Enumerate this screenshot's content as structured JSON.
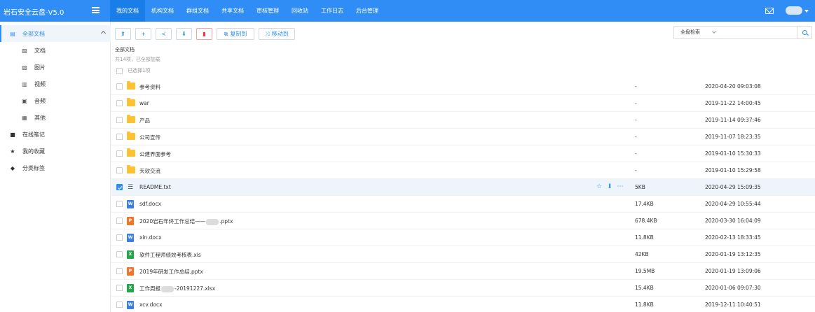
{
  "app": {
    "title": "岩石安全云盘-V5.0"
  },
  "nav": [
    {
      "label": "我的文档",
      "active": true
    },
    {
      "label": "机构文档"
    },
    {
      "label": "群组文档"
    },
    {
      "label": "共享文档"
    },
    {
      "label": "审核管理"
    },
    {
      "label": "回收站"
    },
    {
      "label": "工作日志"
    },
    {
      "label": "后台管理"
    }
  ],
  "sidebar": {
    "all_docs": "全部文档",
    "sub": [
      "文档",
      "图片",
      "视频",
      "音频",
      "其他"
    ],
    "notes": "在线笔记",
    "favorites": "我的收藏",
    "tags": "分类标签"
  },
  "toolbar": {
    "copy_label": "复制到",
    "move_label": "移动到"
  },
  "search": {
    "scope": "全盘检索",
    "placeholder": ""
  },
  "breadcrumb": "全部文档",
  "summary": "共14项，已全部加载",
  "select_all_label": "已选择1项",
  "files": [
    {
      "name": "参考资料",
      "type": "folder",
      "size": "-",
      "date": "2020-04-20 09:03:08"
    },
    {
      "name": "war",
      "type": "folder",
      "size": "-",
      "date": "2019-11-22 14:00:45"
    },
    {
      "name": "产品",
      "type": "folder",
      "size": "-",
      "date": "2019-11-14 09:37:46"
    },
    {
      "name": "公司宣传",
      "type": "folder",
      "size": "-",
      "date": "2019-11-07 18:23:35"
    },
    {
      "name": "公建界面参考",
      "type": "folder",
      "size": "-",
      "date": "2019-01-10 15:30:33"
    },
    {
      "name": "天软交流",
      "type": "folder",
      "size": "-",
      "date": "2019-01-10 15:29:58"
    },
    {
      "name": "README.txt",
      "type": "txt",
      "size": "5KB",
      "date": "2020-04-29 15:09:35",
      "selected": true
    },
    {
      "name": "sdf.docx",
      "type": "word",
      "size": "17.4KB",
      "date": "2020-04-29 10:55:44"
    },
    {
      "name_prefix": "2020岩石年终工作总结——",
      "name_suffix": ".pptx",
      "type": "ppt",
      "size": "678.4KB",
      "date": "2020-03-30 16:04:09"
    },
    {
      "name": "xin.docx",
      "type": "word",
      "size": "11.8KB",
      "date": "2020-02-13 18:33:45"
    },
    {
      "name": "软件工程师绩效考核表.xls",
      "type": "xls",
      "size": "42KB",
      "date": "2020-01-19 13:12:35"
    },
    {
      "name": "2019年研发工作总结.pptx",
      "type": "ppt",
      "size": "19.5MB",
      "date": "2020-01-19 13:09:06"
    },
    {
      "name_prefix": "工作周报",
      "name_suffix": "-20191227.xlsx",
      "type": "xls",
      "size": "15.4KB",
      "date": "2020-01-06 09:07:30"
    },
    {
      "name": "xcv.docx",
      "type": "word",
      "size": "11.8KB",
      "date": "2019-12-11 10:40:51"
    }
  ],
  "icon_letters": {
    "word": "W",
    "ppt": "P",
    "xls": "X"
  },
  "colors": {
    "primary": "#2f8df5",
    "folder": "#fcc233",
    "word": "#3d7de8",
    "ppt": "#f2762a",
    "xls": "#22a54b",
    "danger": "#ee3333"
  }
}
